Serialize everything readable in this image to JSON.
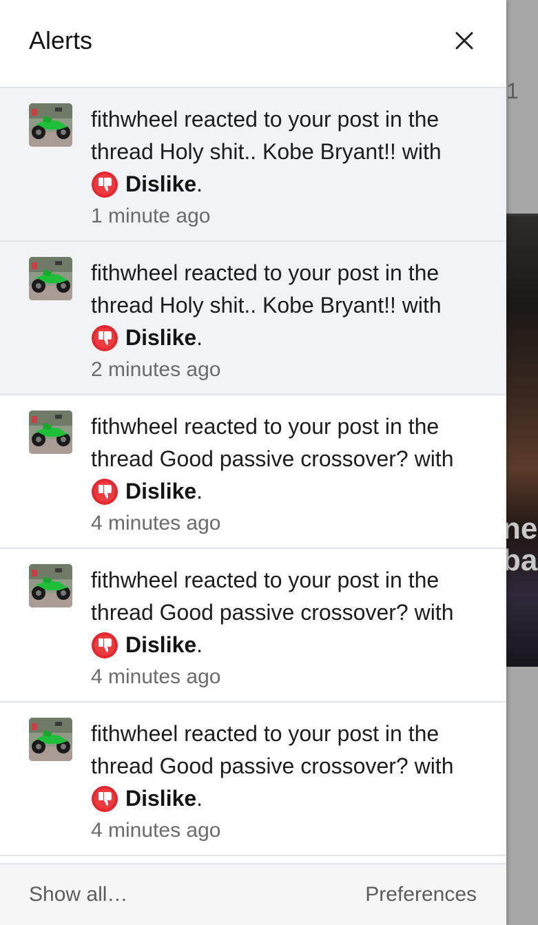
{
  "drawer": {
    "title": "Alerts",
    "close_icon": "close-icon"
  },
  "alerts": [
    {
      "unread": true,
      "avatar_icon": "green-dirtbike-avatar",
      "text": "fithwheel reacted to your post in the thread Holy shit.. Kobe Bryant!! with",
      "reaction_icon": "dislike-icon",
      "reaction": "Dislike",
      "time": "1 minute ago"
    },
    {
      "unread": true,
      "avatar_icon": "green-dirtbike-avatar",
      "text": "fithwheel reacted to your post in the thread Holy shit.. Kobe Bryant!! with",
      "reaction_icon": "dislike-icon",
      "reaction": "Dislike",
      "time": "2 minutes ago"
    },
    {
      "unread": false,
      "avatar_icon": "green-dirtbike-avatar",
      "text": "fithwheel reacted to your post in the thread Good passive crossover? with",
      "reaction_icon": "dislike-icon",
      "reaction": "Dislike",
      "time": "4 minutes ago"
    },
    {
      "unread": false,
      "avatar_icon": "green-dirtbike-avatar",
      "text": "fithwheel reacted to your post in the thread Good passive crossover? with",
      "reaction_icon": "dislike-icon",
      "reaction": "Dislike",
      "time": "4 minutes ago"
    },
    {
      "unread": false,
      "avatar_icon": "green-dirtbike-avatar",
      "text": "fithwheel reacted to your post in the thread Good passive crossover? with",
      "reaction_icon": "dislike-icon",
      "reaction": "Dislike",
      "time": "4 minutes ago"
    }
  ],
  "footer": {
    "show_all": "Show all…",
    "preferences": "Preferences"
  },
  "background": {
    "top_text": "1",
    "headline_line1": "nes",
    "headline_line2": "ba"
  },
  "colors": {
    "unread_bg": "#f2f3f5",
    "divider": "#e1e4e8",
    "dislike_red": "#e0282e",
    "muted_text": "#6b6b6b"
  }
}
